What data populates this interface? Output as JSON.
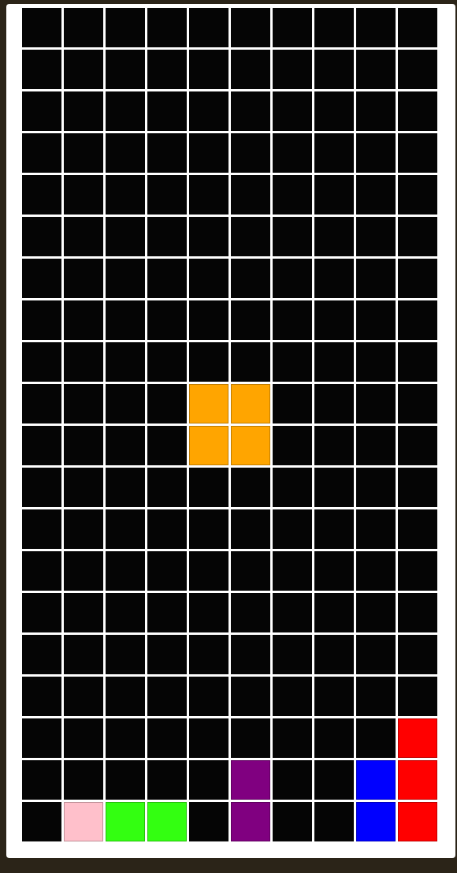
{
  "game": "tetris",
  "board": {
    "rows": 20,
    "cols": 10,
    "cells": [
      {
        "row": 9,
        "col": 4,
        "color": "#FFA500",
        "falling": true
      },
      {
        "row": 9,
        "col": 5,
        "color": "#FFA500",
        "falling": true
      },
      {
        "row": 10,
        "col": 4,
        "color": "#FFA500",
        "falling": true
      },
      {
        "row": 10,
        "col": 5,
        "color": "#FFA500",
        "falling": true
      },
      {
        "row": 17,
        "col": 9,
        "color": "#FF0000",
        "falling": false
      },
      {
        "row": 18,
        "col": 9,
        "color": "#FF0000",
        "falling": false
      },
      {
        "row": 19,
        "col": 9,
        "color": "#FF0000",
        "falling": false
      },
      {
        "row": 18,
        "col": 8,
        "color": "#0000FF",
        "falling": false
      },
      {
        "row": 19,
        "col": 8,
        "color": "#0000FF",
        "falling": false
      },
      {
        "row": 18,
        "col": 5,
        "color": "#800080",
        "falling": false
      },
      {
        "row": 19,
        "col": 5,
        "color": "#800080",
        "falling": false
      },
      {
        "row": 19,
        "col": 1,
        "color": "#FFC0CB",
        "falling": false
      },
      {
        "row": 19,
        "col": 2,
        "color": "#33FF11",
        "falling": false
      },
      {
        "row": 19,
        "col": 3,
        "color": "#33FF11",
        "falling": false
      }
    ]
  }
}
